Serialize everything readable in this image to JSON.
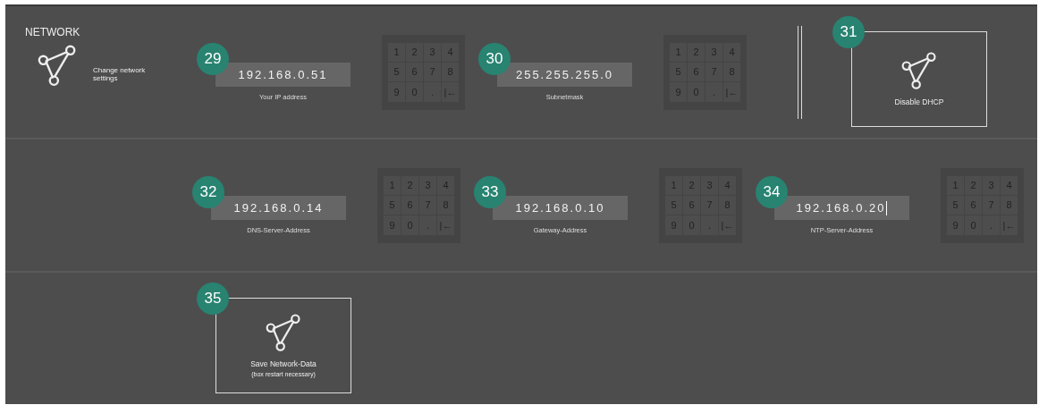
{
  "header": {
    "title": "NETWORK",
    "subtitle": "Change network settings"
  },
  "rows": [
    {
      "items": [
        {
          "kind": "field",
          "badge": "29",
          "value": "192.168.0.51",
          "label": "Your IP address",
          "focused": false,
          "keypad": [
            "1",
            "2",
            "3",
            "4",
            "5",
            "6",
            "7",
            "8",
            "9",
            "0",
            ".",
            "|←"
          ]
        },
        {
          "kind": "field",
          "badge": "30",
          "value": "255.255.255.0",
          "label": "Subnetmask",
          "focused": false,
          "keypad": [
            "1",
            "2",
            "3",
            "4",
            "5",
            "6",
            "7",
            "8",
            "9",
            "0",
            ".",
            "|←"
          ]
        },
        {
          "kind": "divider"
        },
        {
          "kind": "button",
          "badge": "31",
          "label": "Disable  DHCP"
        }
      ]
    },
    {
      "items": [
        {
          "kind": "field",
          "badge": "32",
          "value": "192.168.0.14",
          "label": "DNS-Server-Address",
          "focused": false,
          "keypad": [
            "1",
            "2",
            "3",
            "4",
            "5",
            "6",
            "7",
            "8",
            "9",
            "0",
            ".",
            "|←"
          ]
        },
        {
          "kind": "field",
          "badge": "33",
          "value": "192.168.0.10",
          "label": "Gateway-Address",
          "focused": false,
          "keypad": [
            "1",
            "2",
            "3",
            "4",
            "5",
            "6",
            "7",
            "8",
            "9",
            "0",
            ".",
            "|←"
          ]
        },
        {
          "kind": "field",
          "badge": "34",
          "value": "192.168.0.20",
          "label": "NTP-Server-Address",
          "focused": true,
          "keypad": [
            "1",
            "2",
            "3",
            "4",
            "5",
            "6",
            "7",
            "8",
            "9",
            "0",
            ".",
            "|←"
          ]
        }
      ]
    },
    {
      "items": [
        {
          "kind": "button",
          "badge": "35",
          "label": "Save Network-Data",
          "note": "(box restart necessary)"
        }
      ]
    }
  ]
}
